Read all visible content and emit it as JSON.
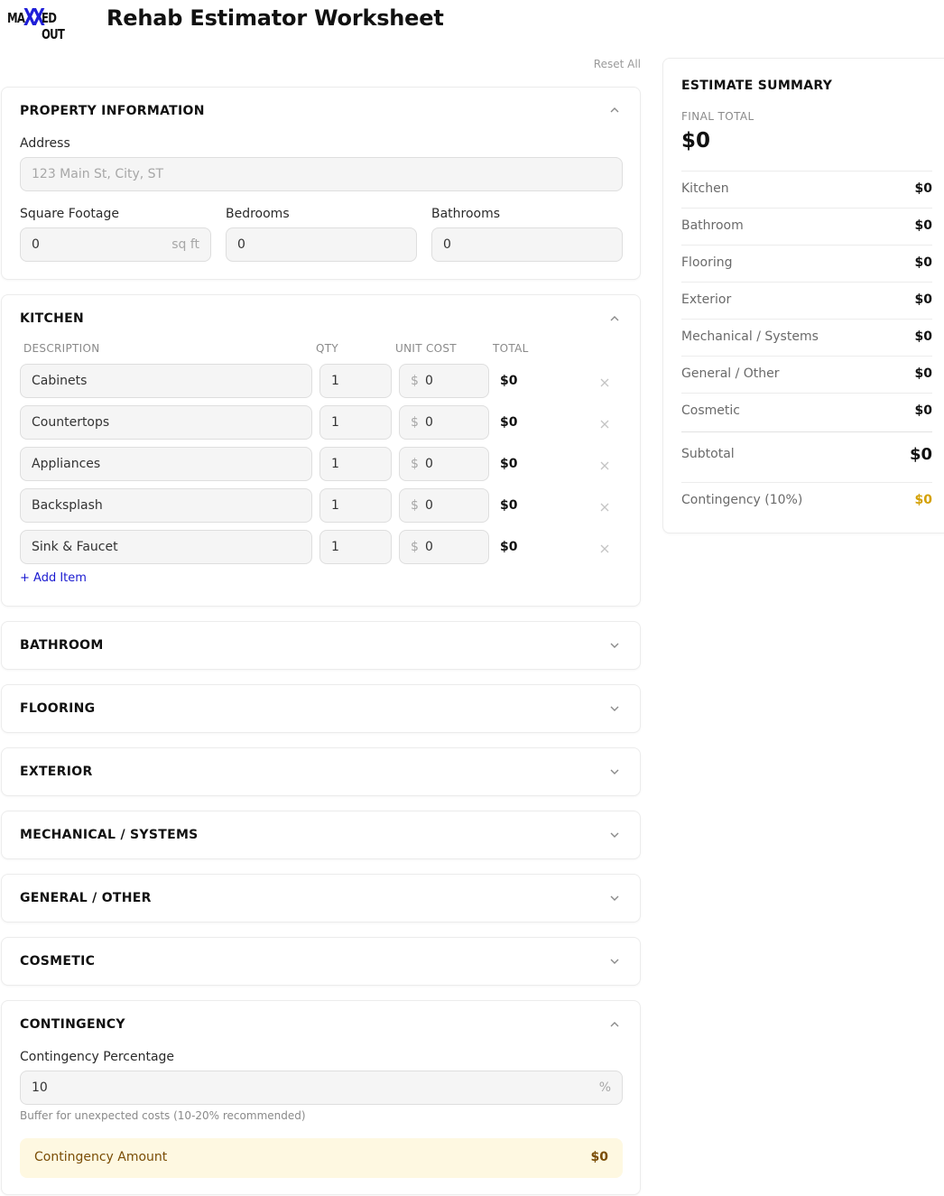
{
  "app": {
    "logo_text_left": "MA",
    "logo_text_x": "XX",
    "logo_text_right": "ED OUT",
    "title": "Rehab Estimator Worksheet"
  },
  "actions": {
    "reset_all": "Reset All"
  },
  "property": {
    "heading": "PROPERTY INFORMATION",
    "address_label": "Address",
    "address_placeholder": "123 Main St, City, ST",
    "sqft_label": "Square Footage",
    "sqft_value": "0",
    "sqft_suffix": "sq ft",
    "bedrooms_label": "Bedrooms",
    "bedrooms_value": "0",
    "bathrooms_label": "Bathrooms",
    "bathrooms_value": "0"
  },
  "kitchen": {
    "heading": "KITCHEN",
    "columns": {
      "description": "DESCRIPTION",
      "qty": "QTY",
      "unit_cost": "UNIT COST",
      "total": "TOTAL"
    },
    "currency_prefix": "$",
    "items": [
      {
        "description": "Cabinets",
        "qty": "1",
        "unit_cost": "0",
        "total": "$0"
      },
      {
        "description": "Countertops",
        "qty": "1",
        "unit_cost": "0",
        "total": "$0"
      },
      {
        "description": "Appliances",
        "qty": "1",
        "unit_cost": "0",
        "total": "$0"
      },
      {
        "description": "Backsplash",
        "qty": "1",
        "unit_cost": "0",
        "total": "$0"
      },
      {
        "description": "Sink & Faucet",
        "qty": "1",
        "unit_cost": "0",
        "total": "$0"
      }
    ],
    "add_item": "+ Add Item"
  },
  "collapsed_sections": [
    {
      "heading": "BATHROOM"
    },
    {
      "heading": "FLOORING"
    },
    {
      "heading": "EXTERIOR"
    },
    {
      "heading": "MECHANICAL / SYSTEMS"
    },
    {
      "heading": "GENERAL / OTHER"
    },
    {
      "heading": "COSMETIC"
    }
  ],
  "contingency": {
    "heading": "CONTINGENCY",
    "percentage_label": "Contingency Percentage",
    "percentage_value": "10",
    "percentage_suffix": "%",
    "help_text": "Buffer for unexpected costs (10-20% recommended)",
    "amount_label": "Contingency Amount",
    "amount_value": "$0"
  },
  "summary": {
    "heading": "ESTIMATE SUMMARY",
    "final_total_label": "FINAL TOTAL",
    "final_total_value": "$0",
    "rows": [
      {
        "label": "Kitchen",
        "value": "$0"
      },
      {
        "label": "Bathroom",
        "value": "$0"
      },
      {
        "label": "Flooring",
        "value": "$0"
      },
      {
        "label": "Exterior",
        "value": "$0"
      },
      {
        "label": "Mechanical / Systems",
        "value": "$0"
      },
      {
        "label": "General / Other",
        "value": "$0"
      },
      {
        "label": "Cosmetic",
        "value": "$0"
      }
    ],
    "subtotal_label": "Subtotal",
    "subtotal_value": "$0",
    "contingency_label": "Contingency (10%)",
    "contingency_value": "$0"
  },
  "colors": {
    "accent_link": "#1a1ad0",
    "logo_x": "#1e1ed8",
    "contingency_amount": "#d4a106",
    "contingency_bg": "#fef8e1"
  }
}
